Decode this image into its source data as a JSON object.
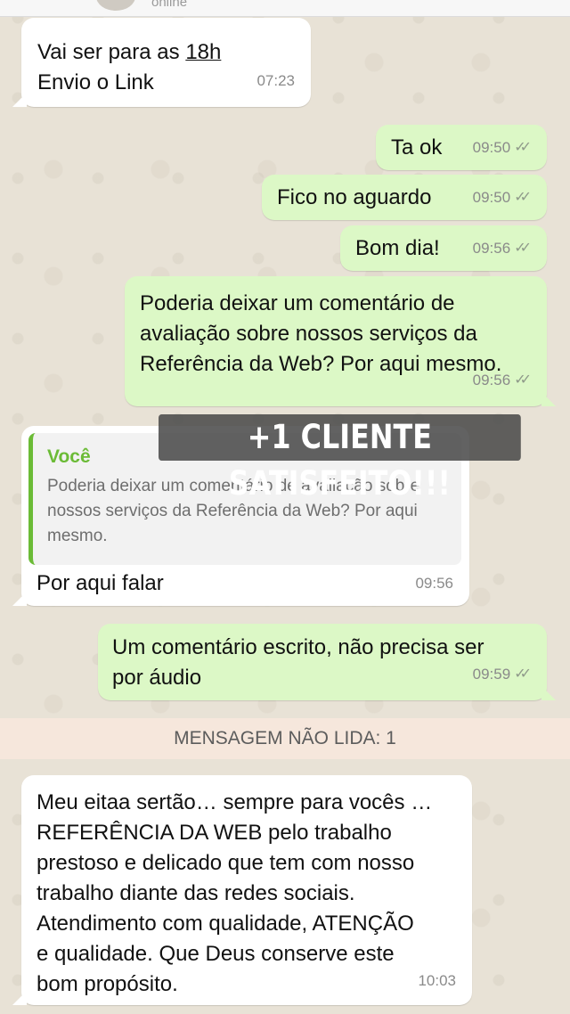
{
  "header": {
    "status": "online"
  },
  "messages": [
    {
      "id": "m1",
      "direction": "in",
      "lines": [
        "Vai ser para as ",
        "18h",
        "Envio o Link"
      ],
      "time": "07:23"
    },
    {
      "id": "m2",
      "direction": "out",
      "text": "Ta ok",
      "time": "09:50",
      "ticks": "✓✓"
    },
    {
      "id": "m3",
      "direction": "out",
      "text": "Fico no aguardo",
      "time": "09:50",
      "ticks": "✓✓"
    },
    {
      "id": "m4",
      "direction": "out",
      "text": "Bom dia!",
      "time": "09:56",
      "ticks": "✓✓"
    },
    {
      "id": "m5",
      "direction": "out",
      "text": "Poderia deixar um comentário de\navaliação sobre nossos serviços da\nReferência da Web? Por aqui mesmo.",
      "time": "09:56",
      "ticks": "✓✓"
    },
    {
      "id": "m6",
      "direction": "in",
      "quote": {
        "author": "Você",
        "text": "Poderia deixar um comentário de avaliação sobre\nnossos serviços da Referência da Web? Por aqui\nmesmo."
      },
      "text": "Por aqui falar",
      "time": "09:56"
    },
    {
      "id": "m7",
      "direction": "out",
      "text": "Um comentário escrito, não precisa ser\npor áudio",
      "time": "09:59",
      "ticks": "✓✓"
    },
    {
      "id": "m8",
      "direction": "in",
      "text": "Meu eitaa sertão… sempre para vocês …\nREFERÊNCIA DA WEB pelo trabalho\nprestoso e delicado que tem com nosso\ntrabalho diante das redes sociais.\nAtendimento com qualidade, ATENÇÃO\ne qualidade. Que Deus conserve este\nbom propósito.",
      "time": "10:03"
    }
  ],
  "unread_banner": "MENSAGEM NÃO LIDA: 1",
  "overlay_caption": "+1 CLIENTE SATISFEITO!!!",
  "colors": {
    "outgoing": "#dcf8c6",
    "incoming": "#ffffff",
    "quote_accent": "#6bbb36",
    "unread_bg": "#f6e7dc"
  }
}
